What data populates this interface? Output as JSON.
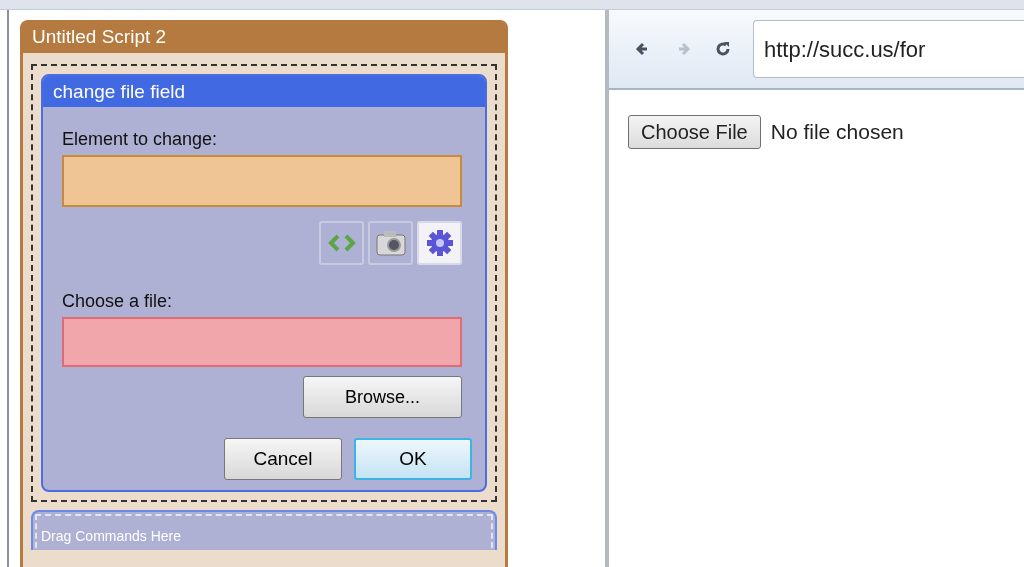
{
  "script_window": {
    "title": "Untitled Script 2",
    "command": {
      "title": "change file field",
      "fields": [
        {
          "label": "Element to change:",
          "kind": "element"
        },
        {
          "label": "Choose a file:",
          "kind": "file",
          "browse_button": "Browse..."
        }
      ],
      "buttons": [
        {
          "label": "Cancel",
          "default": false
        },
        {
          "label": "OK",
          "default": true
        }
      ],
      "drop_zone": "Drag Commands Here"
    }
  },
  "browser": {
    "nav": [
      {
        "kind": "back",
        "disabled": false
      },
      {
        "kind": "forward",
        "disabled": true
      },
      {
        "kind": "reload",
        "disabled": false
      }
    ],
    "url": "http://succ.us/for",
    "file_button": "Choose File",
    "file_status": "No file chosen"
  }
}
